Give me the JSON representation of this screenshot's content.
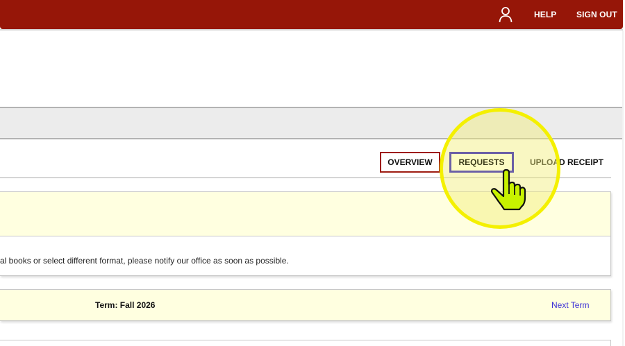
{
  "header": {
    "help_label": "HELP",
    "signout_label": "SIGN OUT",
    "user_icon": "user-icon",
    "bar_color": "#961608"
  },
  "tabs": [
    {
      "label": "OVERVIEW"
    },
    {
      "label": "REQUESTS"
    },
    {
      "label": "UPLOAD RECEIPT"
    }
  ],
  "notice": {
    "text": "al books or select different format, please notify our office as soon as possible."
  },
  "term": {
    "label": "Term: Fall 2026",
    "next_label": "Next Term"
  },
  "overlay": {
    "cursor_icon": "hand-pointer-icon",
    "highlight_color": "#f4f000"
  }
}
